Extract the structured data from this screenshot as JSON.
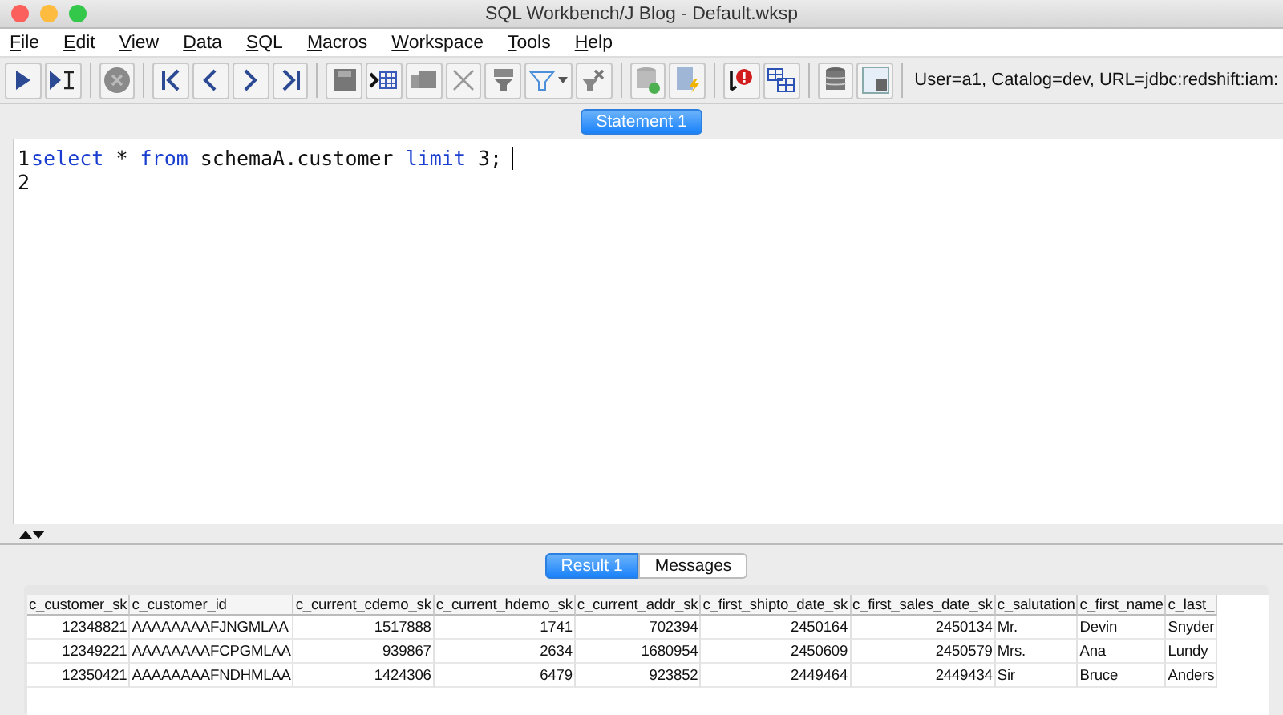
{
  "window": {
    "title": "SQL Workbench/J Blog - Default.wksp"
  },
  "menu": [
    "File",
    "Edit",
    "View",
    "Data",
    "SQL",
    "Macros",
    "Workspace",
    "Tools",
    "Help"
  ],
  "connection_info": "User=a1, Catalog=dev, URL=jdbc:redshift:iam:",
  "editor_tabs": [
    {
      "label": "Statement 1",
      "selected": true
    }
  ],
  "editor": {
    "line_numbers": [
      "1",
      "2"
    ],
    "lines": [
      [
        {
          "text": "select",
          "kind": "keyword"
        },
        {
          "text": " * ",
          "kind": "plain"
        },
        {
          "text": "from",
          "kind": "keyword"
        },
        {
          "text": " schemaA.customer ",
          "kind": "plain"
        },
        {
          "text": "limit",
          "kind": "keyword"
        },
        {
          "text": " 3;",
          "kind": "plain"
        }
      ]
    ]
  },
  "result_tabs": [
    {
      "label": "Result 1",
      "selected": true
    },
    {
      "label": "Messages",
      "selected": false
    }
  ],
  "table": {
    "columns": [
      {
        "label": "c_customer_sk",
        "kind": "numeric"
      },
      {
        "label": "c_customer_id",
        "kind": "text"
      },
      {
        "label": "c_current_cdemo_sk",
        "kind": "numeric"
      },
      {
        "label": "c_current_hdemo_sk",
        "kind": "numeric"
      },
      {
        "label": "c_current_addr_sk",
        "kind": "numeric"
      },
      {
        "label": "c_first_shipto_date_sk",
        "kind": "numeric"
      },
      {
        "label": "c_first_sales_date_sk",
        "kind": "numeric"
      },
      {
        "label": "c_salutation",
        "kind": "text"
      },
      {
        "label": "c_first_name",
        "kind": "text"
      },
      {
        "label": "c_last_",
        "kind": "text"
      }
    ],
    "rows": [
      [
        "12348821",
        "AAAAAAAAFJNGMLAA",
        "1517888",
        "1741",
        "702394",
        "2450164",
        "2450134",
        "Mr.",
        "Devin",
        "Snyder"
      ],
      [
        "12349221",
        "AAAAAAAAFCPGMLAA",
        "939867",
        "2634",
        "1680954",
        "2450609",
        "2450579",
        "Mrs.",
        "Ana",
        "Lundy"
      ],
      [
        "12350421",
        "AAAAAAAAFNDHMLAA",
        "1424306",
        "6479",
        "923852",
        "2449464",
        "2449434",
        "Sir",
        "Bruce",
        "Anders"
      ]
    ]
  }
}
